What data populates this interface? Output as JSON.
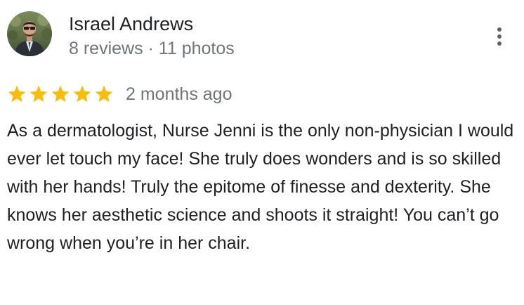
{
  "review": {
    "author": {
      "name": "Israel Andrews",
      "meta": "8 reviews · 11 photos",
      "avatar_icon": "user-photo"
    },
    "rating": {
      "stars": 5,
      "max_stars": 5,
      "star_icon": "star-icon",
      "star_color": "#fbbc04"
    },
    "date": "2 months ago",
    "text": "As a dermatologist, Nurse Jenni is the only non-physician I would ever let touch my face! She truly does wonders and is so skilled with her hands! Truly the epitome of finesse and dexterity. She knows her aesthetic science and shoots it straight! You can’t go wrong when you’re in her chair.",
    "menu_icon": "more-vert-icon"
  }
}
